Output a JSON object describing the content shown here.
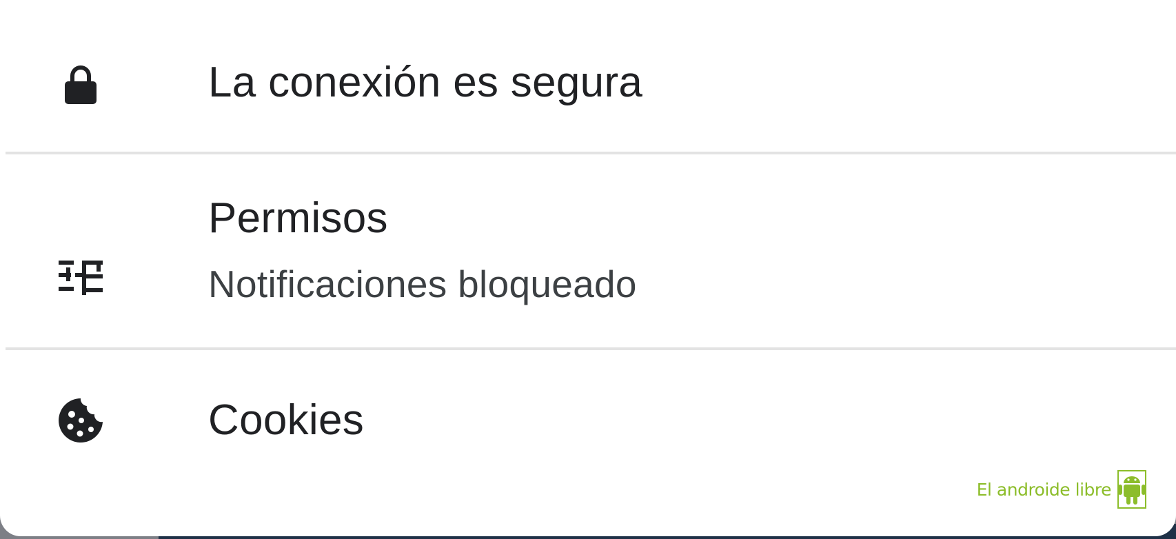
{
  "site_info_sheet": {
    "connection": {
      "icon": "lock-icon",
      "title": "La conexión es segura"
    },
    "permissions": {
      "icon": "tune-sliders-icon",
      "title": "Permisos",
      "subtitle": "Notificaciones bloqueado"
    },
    "cookies": {
      "icon": "cookie-icon",
      "title": "Cookies"
    }
  },
  "watermark": {
    "text": "El androide libre",
    "icon": "android-robot-logo"
  },
  "colors": {
    "text_primary": "#202124",
    "text_secondary": "#3c4043",
    "divider": "#e3e3e3",
    "watermark": "#8cbd2a"
  }
}
